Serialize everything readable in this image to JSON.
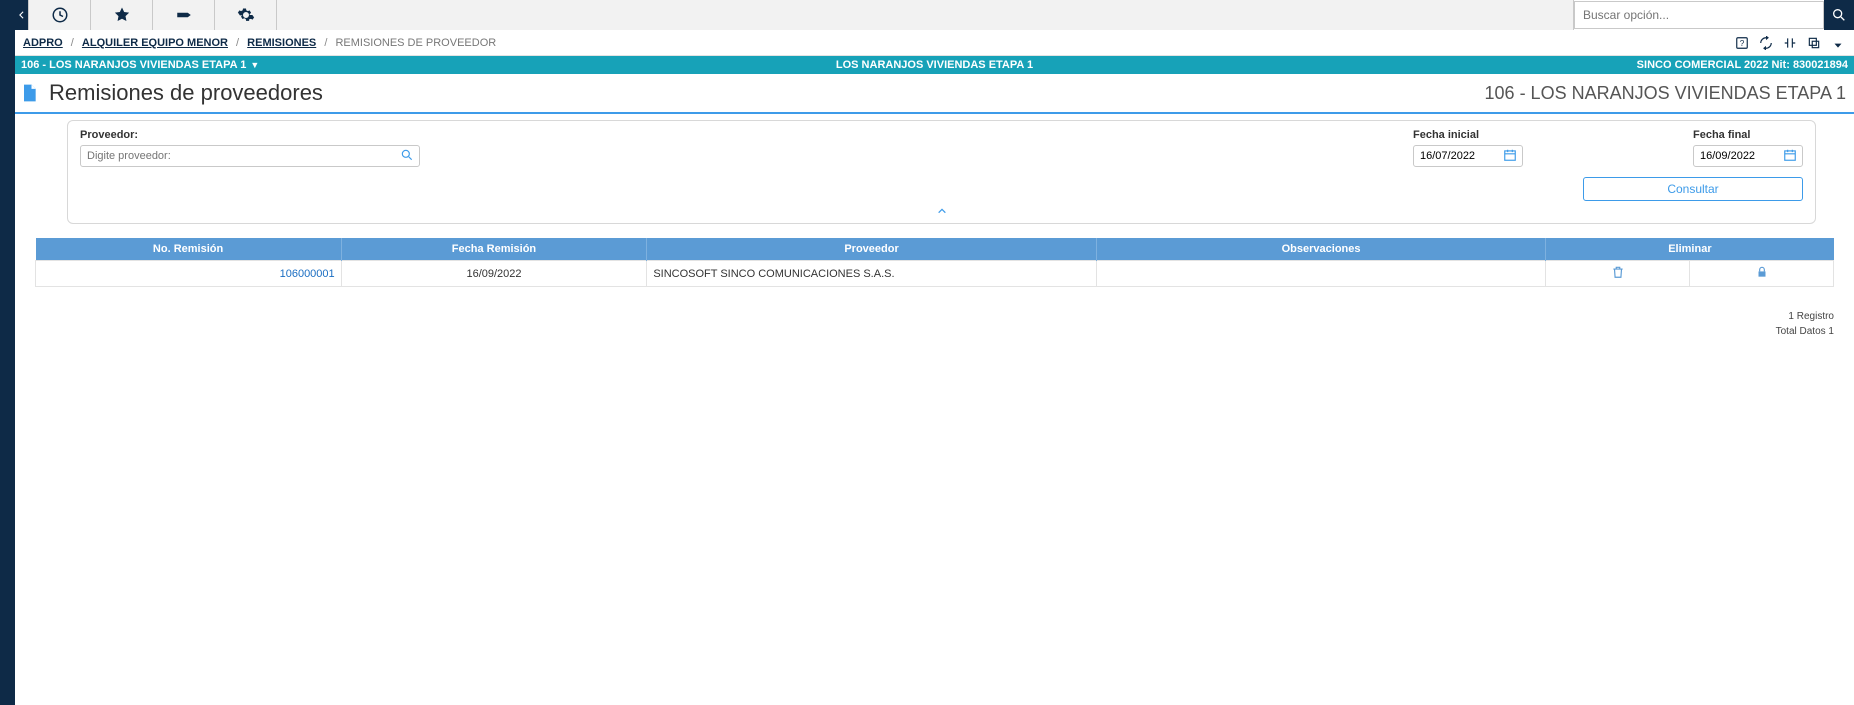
{
  "topbar": {
    "search_placeholder": "Buscar opción..."
  },
  "breadcrumb": {
    "items": [
      "ADPRO",
      "ALQUILER EQUIPO MENOR",
      "REMISIONES"
    ],
    "current": "REMISIONES DE PROVEEDOR"
  },
  "context": {
    "left": "106 - LOS NARANJOS VIVIENDAS ETAPA 1",
    "center": "LOS NARANJOS VIVIENDAS ETAPA 1",
    "right": "SINCO COMERCIAL 2022 Nit: 830021894"
  },
  "title": {
    "heading": "Remisiones de proveedores",
    "project": "106 - LOS NARANJOS VIVIENDAS ETAPA 1"
  },
  "filters": {
    "proveedor_label": "Proveedor:",
    "proveedor_placeholder": "Digite proveedor:",
    "fecha_inicial_label": "Fecha inicial",
    "fecha_inicial_value": "16/07/2022",
    "fecha_final_label": "Fecha final",
    "fecha_final_value": "16/09/2022",
    "consultar_label": "Consultar"
  },
  "grid": {
    "headers": {
      "no_remision": "No. Remisión",
      "fecha_remision": "Fecha Remisión",
      "proveedor": "Proveedor",
      "observaciones": "Observaciones",
      "eliminar": "Eliminar"
    },
    "rows": [
      {
        "no_remision": "106000001",
        "fecha_remision": "16/09/2022",
        "proveedor": "SINCOSOFT SINCO COMUNICACIONES S.A.S.",
        "observaciones": ""
      }
    ]
  },
  "footer": {
    "registro": "1 Registro",
    "total": "Total Datos 1"
  }
}
